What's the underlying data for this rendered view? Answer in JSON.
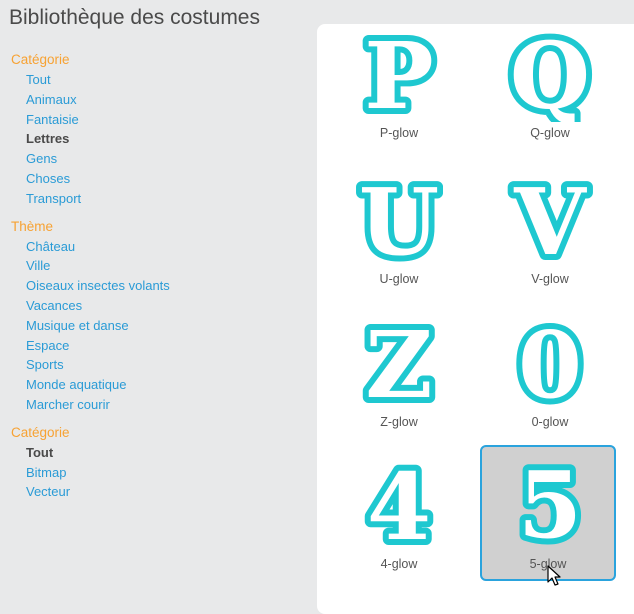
{
  "window": {
    "title": "Bibliothèque des costumes"
  },
  "sidebar": {
    "groups": [
      {
        "label": "Catégorie",
        "items": [
          {
            "label": "Tout"
          },
          {
            "label": "Animaux"
          },
          {
            "label": "Fantaisie"
          },
          {
            "label": "Lettres",
            "selected": true
          },
          {
            "label": "Gens"
          },
          {
            "label": "Choses"
          },
          {
            "label": "Transport"
          }
        ]
      },
      {
        "label": "Thème",
        "items": [
          {
            "label": "Château"
          },
          {
            "label": "Ville"
          },
          {
            "label": "Oiseaux insectes volants"
          },
          {
            "label": "Vacances"
          },
          {
            "label": "Musique et danse"
          },
          {
            "label": "Espace"
          },
          {
            "label": "Sports"
          },
          {
            "label": "Monde aquatique"
          },
          {
            "label": "Marcher courir"
          }
        ]
      },
      {
        "label": "Catégorie",
        "items": [
          {
            "label": "Tout",
            "selected": true
          },
          {
            "label": "Bitmap"
          },
          {
            "label": "Vecteur"
          }
        ]
      }
    ]
  },
  "costumes": [
    {
      "name": "P-glow",
      "glyph": "P",
      "icon": "letter-p-glow-icon"
    },
    {
      "name": "Q-glow",
      "glyph": "Q",
      "icon": "letter-q-glow-icon"
    },
    {
      "name": "U-glow",
      "glyph": "U",
      "icon": "letter-u-glow-icon"
    },
    {
      "name": "V-glow",
      "glyph": "V",
      "icon": "letter-v-glow-icon"
    },
    {
      "name": "Z-glow",
      "glyph": "Z",
      "icon": "letter-z-glow-icon"
    },
    {
      "name": "0-glow",
      "glyph": "0",
      "icon": "digit-0-glow-icon"
    },
    {
      "name": "4-glow",
      "glyph": "4",
      "icon": "digit-4-glow-icon"
    },
    {
      "name": "5-glow",
      "glyph": "5",
      "icon": "digit-5-glow-icon",
      "selected": true
    }
  ],
  "colors": {
    "glow": "#1ec8d0",
    "outline": "#18b7be",
    "accent": "#2aa3dd",
    "category_heading": "#f7a233",
    "link": "#2a9bd6"
  }
}
